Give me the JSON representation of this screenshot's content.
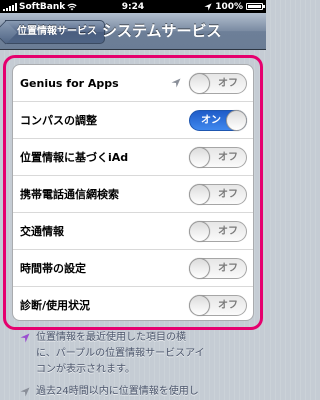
{
  "status_bar": {
    "carrier": "SoftBank",
    "time": "9:24",
    "battery": "100%"
  },
  "nav": {
    "back_label": "位置情報サービス",
    "title": "システムサービス"
  },
  "rows": [
    {
      "label": "Genius for Apps",
      "state": "off",
      "toggle_label": "オフ",
      "location_icon": true
    },
    {
      "label": "コンパスの調整",
      "state": "on",
      "toggle_label": "オン",
      "location_icon": false
    },
    {
      "label": "位置情報に基づくiAd",
      "state": "off",
      "toggle_label": "オフ",
      "location_icon": false
    },
    {
      "label": "携帯電話通信網検索",
      "state": "off",
      "toggle_label": "オフ",
      "location_icon": false
    },
    {
      "label": "交通情報",
      "state": "off",
      "toggle_label": "オフ",
      "location_icon": false
    },
    {
      "label": "時間帯の設定",
      "state": "off",
      "toggle_label": "オフ",
      "location_icon": false
    },
    {
      "label": "診断/使用状況",
      "state": "off",
      "toggle_label": "オフ",
      "location_icon": false
    }
  ],
  "notes": [
    {
      "line1": "位置情報を最近使用した項目の横",
      "line2": "に、パープルの位置情報サービスアイ",
      "line3": "コンが表示されます。",
      "icon_color": "#9b4fd0"
    },
    {
      "line1": "過去24時間以内に位置情報を使用し",
      "icon_color": "#8a8f99"
    }
  ],
  "colors": {
    "highlight_border": "#e5006e",
    "toggle_on": "#2f72de"
  }
}
